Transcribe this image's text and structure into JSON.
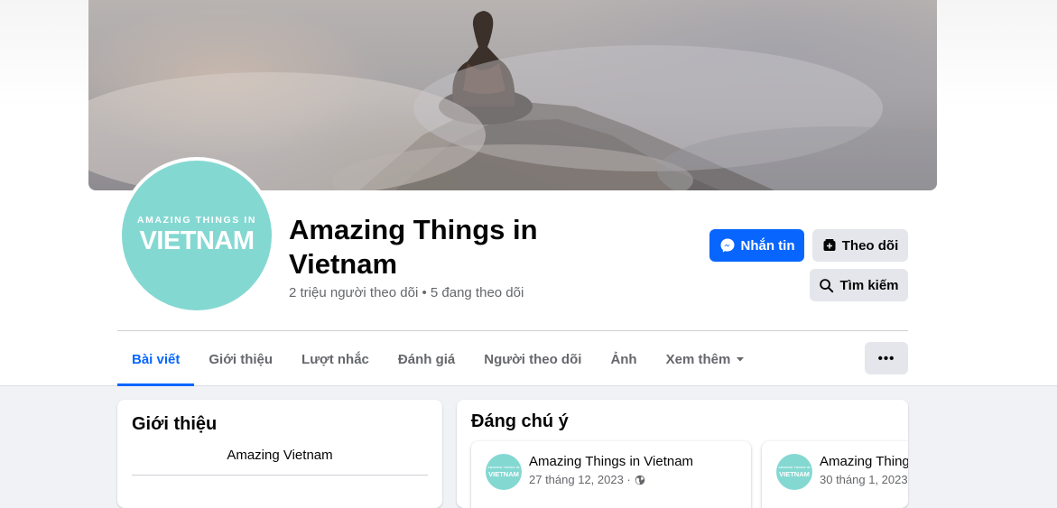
{
  "page": {
    "name": "Amazing Things in Vietnam",
    "stats": "2 triệu người theo dõi • 5 đang theo dõi",
    "avatar_small": "AMAZING THINGS IN",
    "avatar_big": "VIETNAM"
  },
  "actions": {
    "message": "Nhắn tin",
    "follow": "Theo dõi",
    "search": "Tìm kiếm"
  },
  "tabs": [
    {
      "label": "Bài viết",
      "active": true
    },
    {
      "label": "Giới thiệu"
    },
    {
      "label": "Lượt nhắc"
    },
    {
      "label": "Đánh giá"
    },
    {
      "label": "Người theo dõi"
    },
    {
      "label": "Ảnh"
    },
    {
      "label": "Xem thêm"
    }
  ],
  "more_button": "•••",
  "intro": {
    "title": "Giới thiệu",
    "description": "Amazing Vietnam"
  },
  "featured": {
    "title": "Đáng chú ý",
    "posts": [
      {
        "author": "Amazing Things in Vietnam",
        "date": "27 tháng 12, 2023 ·"
      },
      {
        "author": "Amazing Things in Vietnam",
        "date": "30 tháng 1, 2023 ·"
      }
    ]
  },
  "colors": {
    "accent": "#0866ff",
    "avatar_bg": "#84d8d2",
    "secondary_button": "#e4e6eb"
  }
}
